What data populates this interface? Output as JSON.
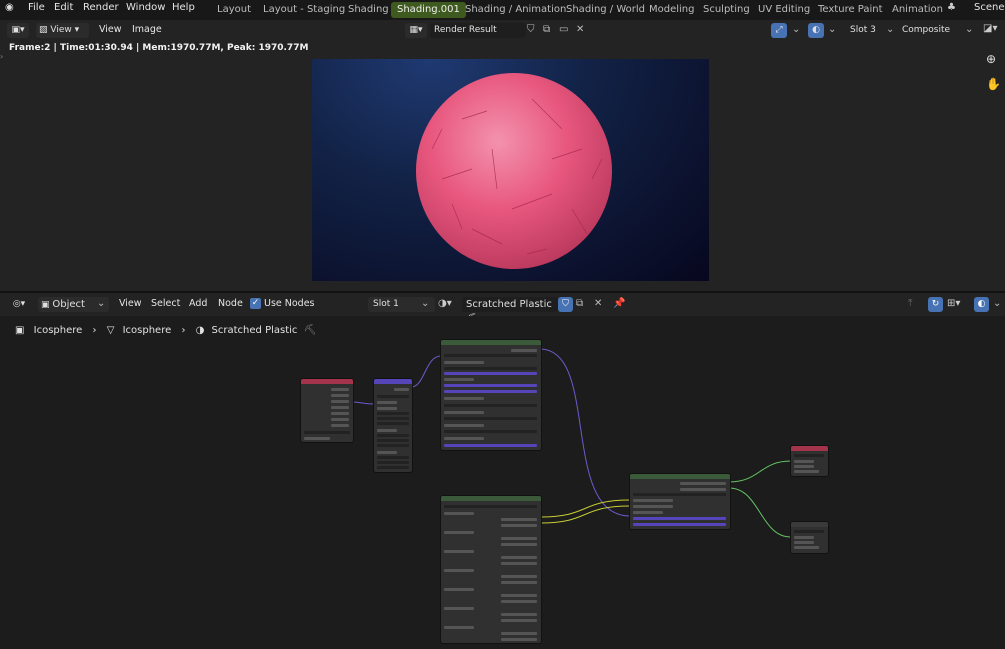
{
  "topbar": {
    "menus": [
      "File",
      "Edit",
      "Render",
      "Window",
      "Help"
    ],
    "workspaces": [
      "Layout",
      "Layout - Staging",
      "Shading",
      "Shading.001",
      "Shading / Animation",
      "Shading / World",
      "Modeling",
      "Sculpting",
      "UV Editing",
      "Texture Paint",
      "Animation"
    ],
    "active_workspace": "Shading.001",
    "scene": "Scene"
  },
  "image_editor": {
    "view_menu": "View",
    "menu_view": "View",
    "menu_image": "Image",
    "image_name": "Render Result",
    "slot": "Slot 3",
    "layer": "Composite",
    "info": "Frame:2 | Time:01:30.94 | Mem:1970.77M, Peak: 1970.77M"
  },
  "node_editor": {
    "mode": "Object",
    "menus": [
      "View",
      "Select",
      "Add",
      "Node"
    ],
    "use_nodes_label": "Use Nodes",
    "use_nodes_checked": true,
    "slot": "Slot 1",
    "material": "Scratched Plastic",
    "breadcrumb": [
      "Icosphere",
      "Icosphere",
      "Scratched Plastic"
    ]
  },
  "colors": {
    "accent": "#4772b3",
    "active_ws": "#3f5a1f",
    "sphere": "#e8577e",
    "node_purple": "#5545b8",
    "node_green": "#3a5a3a",
    "link_yellow": "#c7cc33",
    "link_purple": "#6a5ccc",
    "link_green": "#63c763"
  }
}
